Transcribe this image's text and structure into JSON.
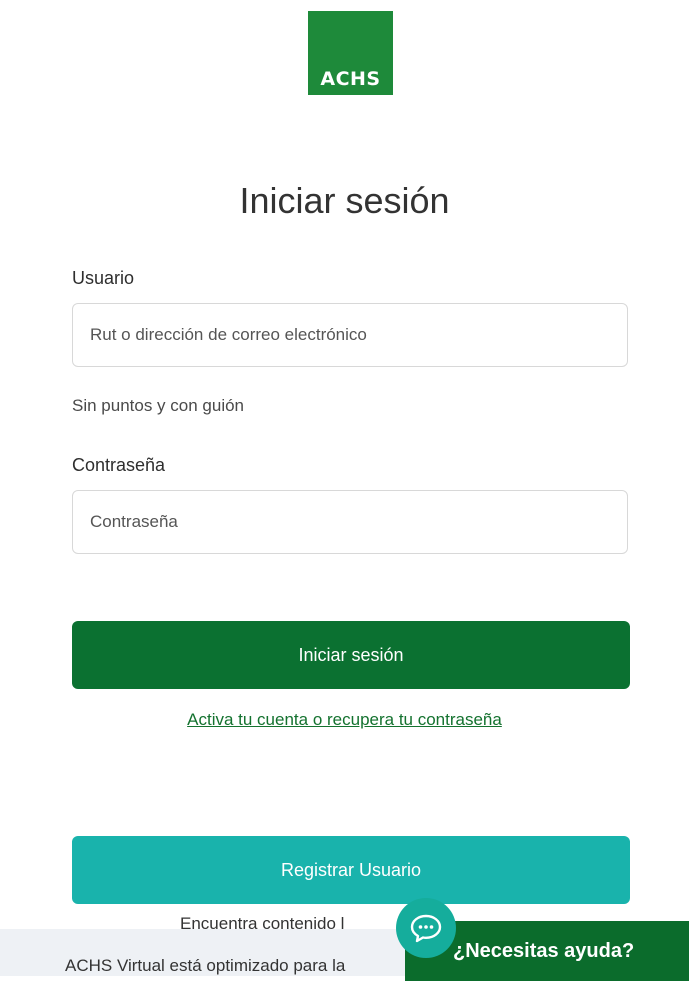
{
  "logo": {
    "text": "ACHS"
  },
  "heading": "Iniciar sesión",
  "user": {
    "label": "Usuario",
    "placeholder": "Rut o dirección de correo electrónico",
    "value": "",
    "hint": "Sin puntos y con guión"
  },
  "password": {
    "label": "Contraseña",
    "placeholder": "Contraseña",
    "value": ""
  },
  "actions": {
    "login_label": "Iniciar sesión",
    "recover_link": "Activa tu cuenta o recupera tu contraseña",
    "register_label": "Registrar Usuario"
  },
  "footer": {
    "partial_text": "Encuentra contenido l",
    "banner_text": "ACHS Virtual está optimizado para la"
  },
  "help": {
    "label": "¿Necesitas ayuda?",
    "icon": "chat-bubble-icon"
  },
  "colors": {
    "brand_green": "#1e8a3a",
    "primary_button": "#0b7131",
    "secondary_button": "#19b3ac",
    "help_pill": "#0b6c2c",
    "chat_circle": "#15ad9c"
  }
}
